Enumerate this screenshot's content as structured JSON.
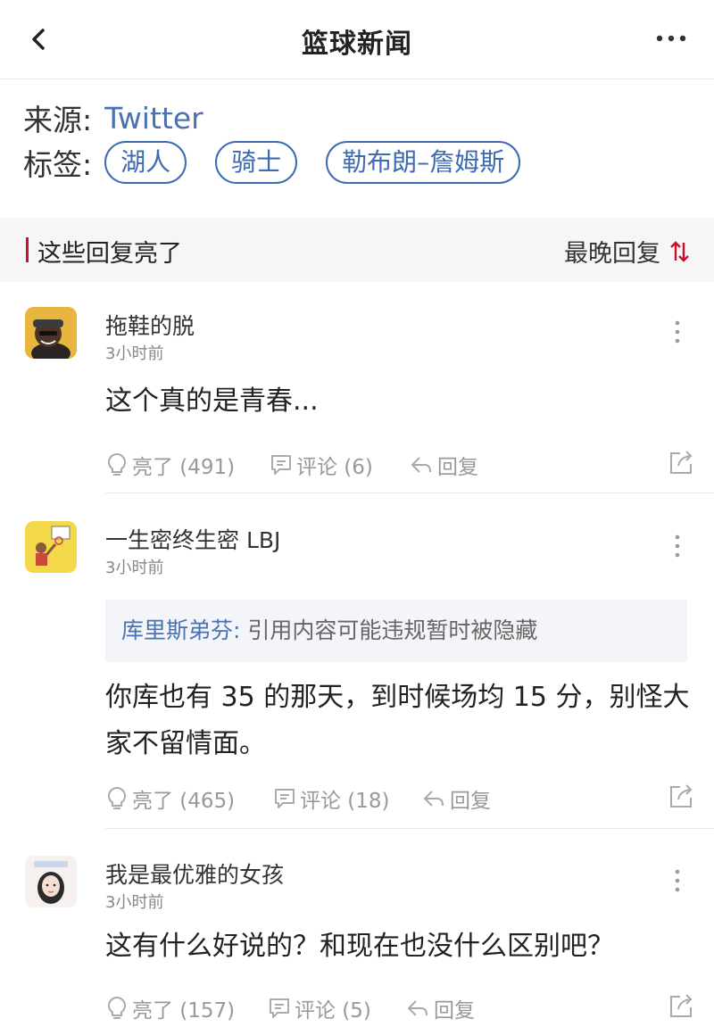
{
  "header": {
    "title": "篮球新闻",
    "back_icon": "chevron-left-icon",
    "more_icon": "more-horizontal-icon"
  },
  "meta": {
    "source_label": "来源:",
    "source_value": "Twitter",
    "tags_label": "标签:",
    "tags": [
      "湖人",
      "骑士",
      "勒布朗–詹姆斯"
    ]
  },
  "section": {
    "title": "这些回复亮了",
    "sort_label": "最晚回复",
    "accent_color": "#c8102e"
  },
  "comments": [
    {
      "username": "拖鞋的脱",
      "time": "3小时前",
      "quote": null,
      "text": "这个真的是青春...",
      "likes": "亮了 (491)",
      "replies": "评论 (6)",
      "reply_label": "回复"
    },
    {
      "username": "一生密终生密 LBJ",
      "time": "3小时前",
      "quote": {
        "author": "库里斯弟芬:",
        "text": " 引用内容可能违规暂时被隐藏"
      },
      "text": "你库也有 35 的那天，到时候场均 15 分，别怪大家不留情面。",
      "likes": "亮了 (465)",
      "replies": "评论 (18)",
      "reply_label": "回复"
    },
    {
      "username": "我是最优雅的女孩",
      "time": "3小时前",
      "quote": null,
      "text": "这有什么好说的？和现在也没什么区别吧？",
      "likes": "亮了 (157)",
      "replies": "评论 (5)",
      "reply_label": "回复"
    }
  ]
}
